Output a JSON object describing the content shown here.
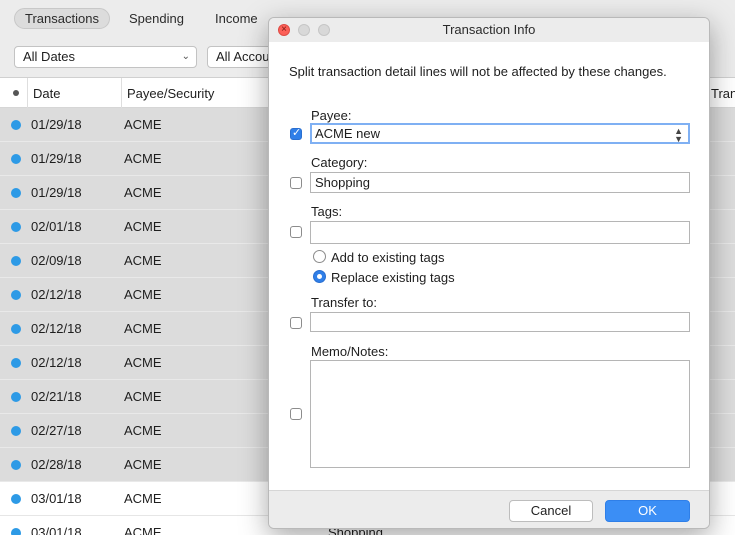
{
  "tabs": [
    "Transactions",
    "Spending",
    "Income"
  ],
  "filters": {
    "date": "All Dates",
    "account": "All Accou"
  },
  "columns": {
    "date": "Date",
    "payee": "Payee/Security",
    "tran": "Tran"
  },
  "rows": [
    {
      "date": "01/29/18",
      "payee": "ACME",
      "category": ""
    },
    {
      "date": "01/29/18",
      "payee": "ACME",
      "category": ""
    },
    {
      "date": "01/29/18",
      "payee": "ACME",
      "category": ""
    },
    {
      "date": "02/01/18",
      "payee": "ACME",
      "category": ""
    },
    {
      "date": "02/09/18",
      "payee": "ACME",
      "category": ""
    },
    {
      "date": "02/12/18",
      "payee": "ACME",
      "category": ""
    },
    {
      "date": "02/12/18",
      "payee": "ACME",
      "category": ""
    },
    {
      "date": "02/12/18",
      "payee": "ACME",
      "category": ""
    },
    {
      "date": "02/21/18",
      "payee": "ACME",
      "category": ""
    },
    {
      "date": "02/27/18",
      "payee": "ACME",
      "category": ""
    },
    {
      "date": "02/28/18",
      "payee": "ACME",
      "category": ""
    },
    {
      "date": "03/01/18",
      "payee": "ACME",
      "category": ""
    },
    {
      "date": "03/01/18",
      "payee": "ACME",
      "category": "Shopping"
    }
  ],
  "dialog": {
    "title": "Transaction Info",
    "note": "Split transaction detail lines will not be affected by these changes.",
    "payee": {
      "label": "Payee:",
      "value": "ACME new",
      "checked": true
    },
    "category": {
      "label": "Category:",
      "value": "Shopping",
      "checked": false
    },
    "tags": {
      "label": "Tags:",
      "value": "",
      "checked": false
    },
    "tag_options": {
      "add": "Add to existing tags",
      "replace": "Replace existing tags",
      "selected": "replace"
    },
    "transfer": {
      "label": "Transfer to:",
      "value": "",
      "checked": false
    },
    "memo": {
      "label": "Memo/Notes:",
      "value": "",
      "checked": false
    },
    "cancel_label": "Cancel",
    "ok_label": "OK"
  },
  "colors": {
    "accent": "#2f7fe8",
    "dot": "#2d9ae6",
    "close": "#fc5f57"
  }
}
